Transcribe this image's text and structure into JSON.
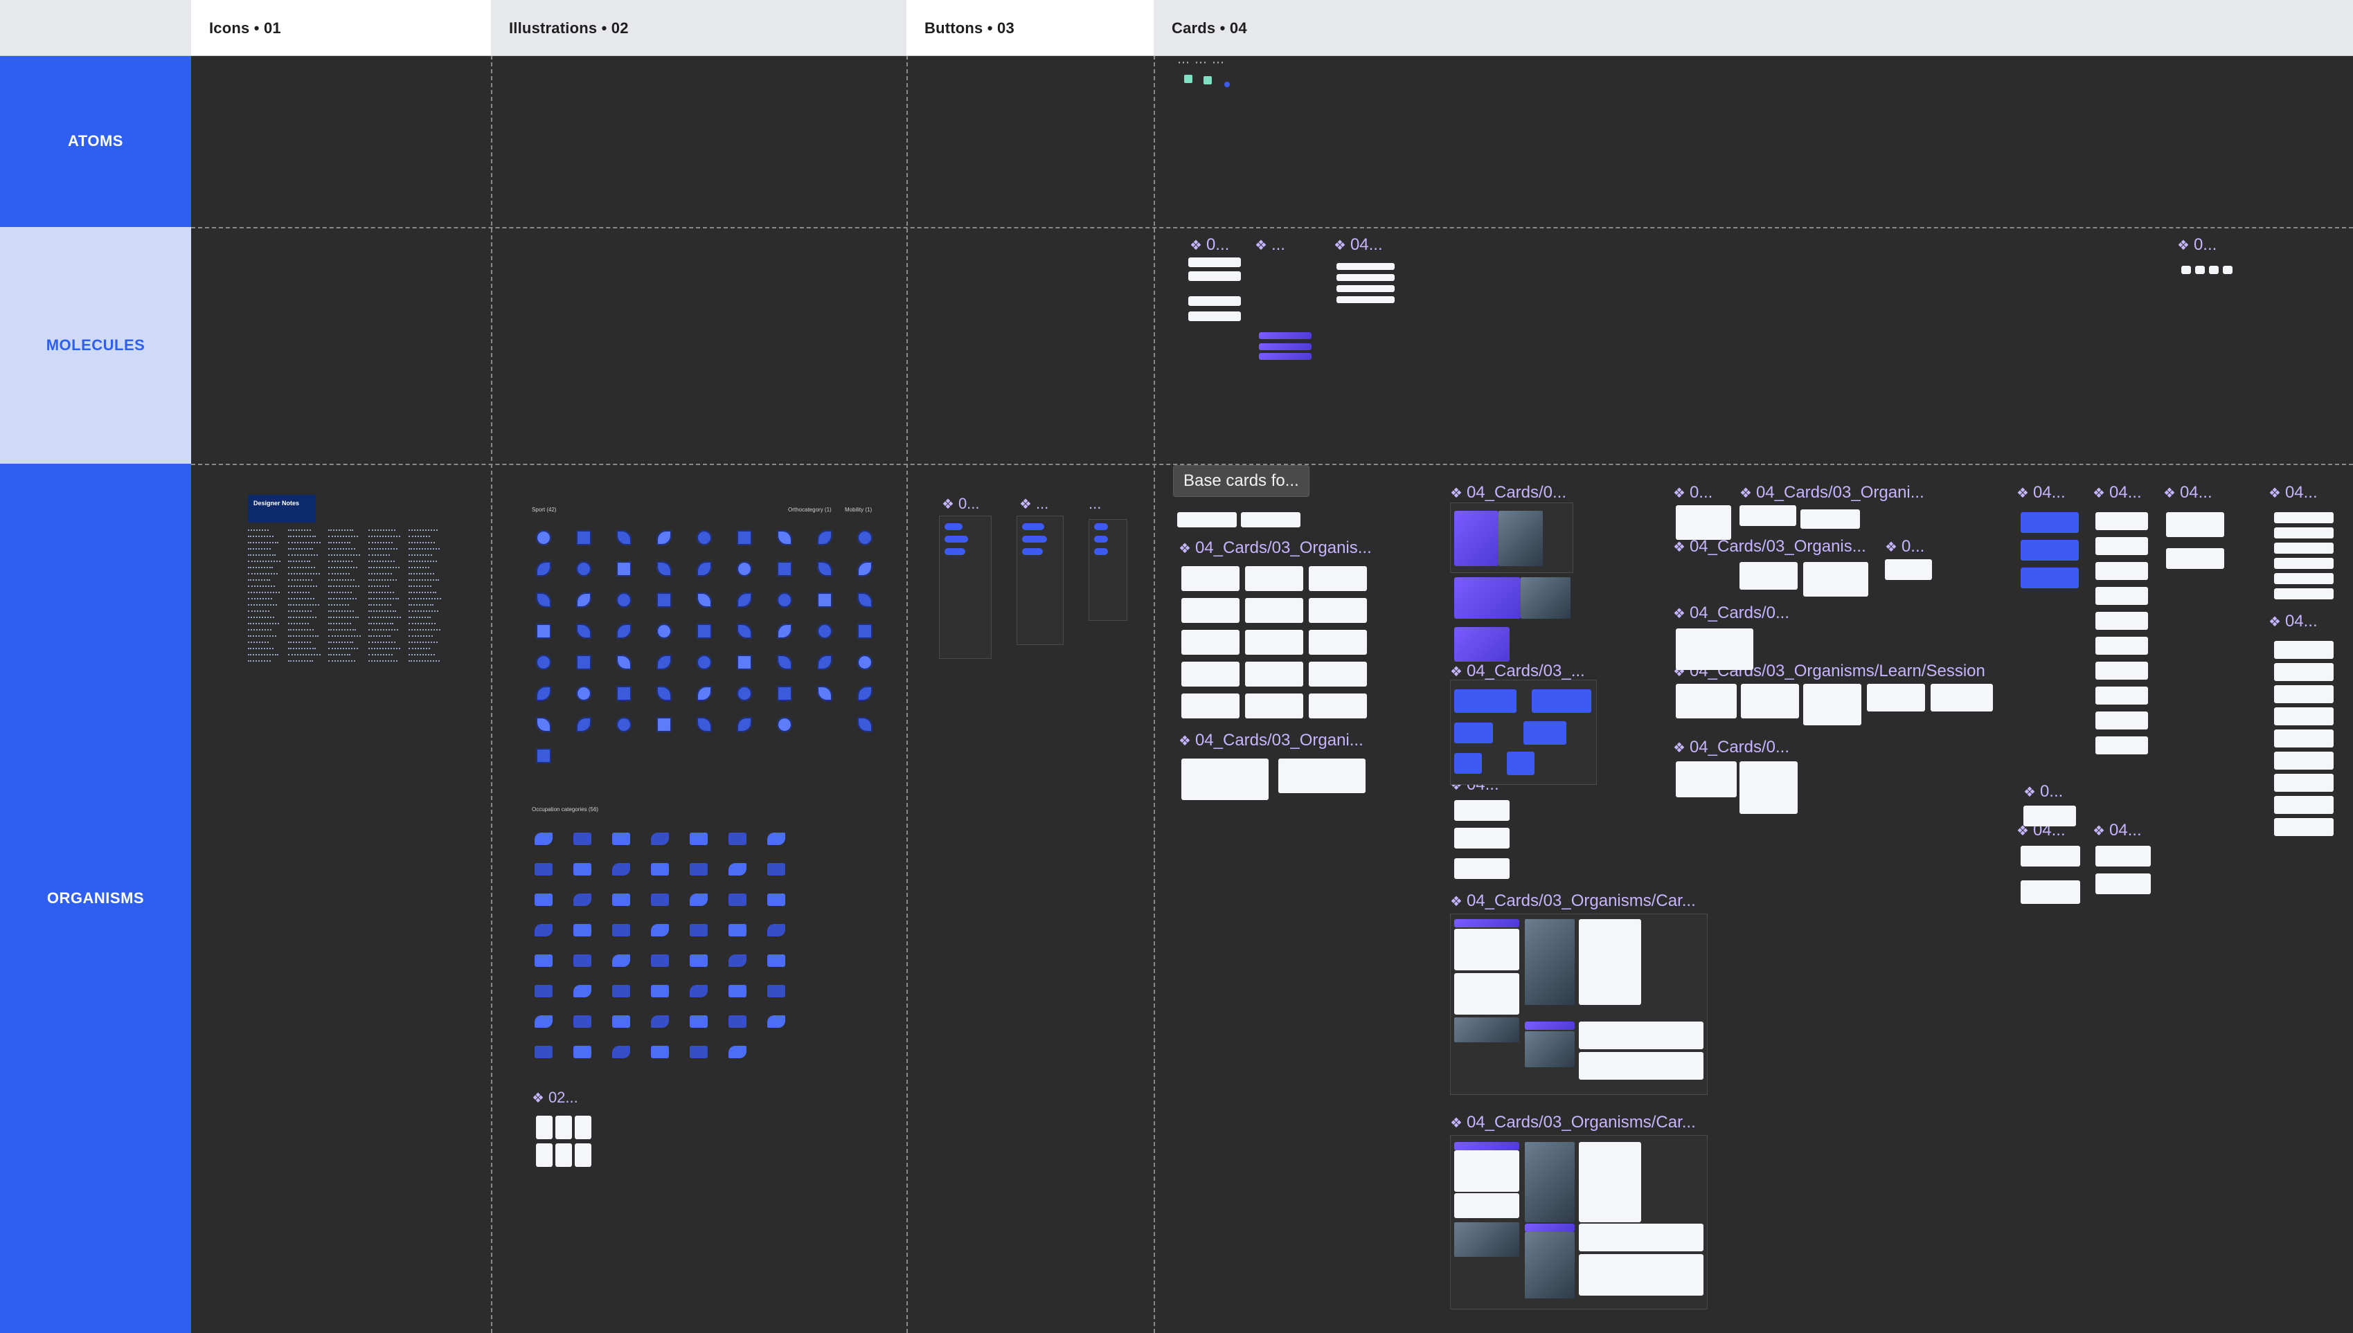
{
  "columns": [
    {
      "label": "Icons • 01",
      "active": true
    },
    {
      "label": "Illustrations • 02",
      "active": false
    },
    {
      "label": "Buttons • 03",
      "active": true
    },
    {
      "label": "Cards • 04",
      "active": false
    }
  ],
  "rows": [
    "ATOMS",
    "MOLECULES",
    "ORGANISMS"
  ],
  "icons_frame": {
    "note_title": "Designer Notes"
  },
  "illustrations": {
    "sport_label": "Sport (42)",
    "orthocategory_label": "Orthocategory (1)",
    "mobility_label": "Mobility (1)",
    "occupation_label": "Occupation categories (56)",
    "frame_02_label": "02..."
  },
  "cards": {
    "tooltip": "Base cards fo...",
    "labels": {
      "l01": "0...",
      "l02": "...",
      "l03": "04...",
      "l04": "0...",
      "l05": "04_Cards/03_Organis...",
      "l06": "04_Cards/0...",
      "l07": "0...",
      "l08": "04_Cards/03_Organi...",
      "l09": "04_Cards/03_Organis...",
      "l10": "0...",
      "l11": "04_Cards/0...",
      "l12": "04_Cards/03_...",
      "l13": "04_Cards/03_Organisms/Learn/Session",
      "l14": "04_Cards/03_Organi...",
      "l15": "04_Cards/0...",
      "l16": "04...",
      "l17": "04_Cards/03_Organisms/Car...",
      "l18": "04_Cards/03_Organisms/Car...",
      "l19": "04...",
      "l20": "04...",
      "l21": "04...",
      "l22": "04...",
      "l23": "0...",
      "l24": "04...",
      "l25": "04...",
      "l26": "04...",
      "l27": "0...",
      "l28": "04..."
    }
  },
  "buttons": {
    "l01": "0...",
    "l02": "...",
    "l03": "..."
  }
}
